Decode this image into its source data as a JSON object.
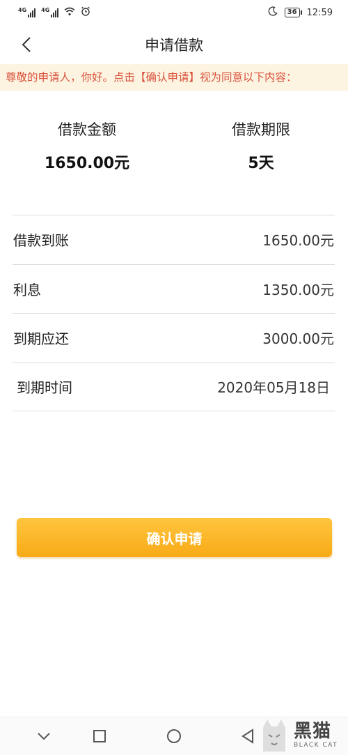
{
  "status_bar": {
    "network_1": "4G",
    "network_2": "4G",
    "battery": "36",
    "time": "12:59"
  },
  "header": {
    "title": "申请借款"
  },
  "notice": {
    "text": "尊敬的申请人，你好。点击【确认申请】视为同意以下内容："
  },
  "summary": {
    "amount_label": "借款金额",
    "amount_value": "1650.00元",
    "term_label": "借款期限",
    "term_value": "5天"
  },
  "details": [
    {
      "label": "借款到账",
      "value": "1650.00元"
    },
    {
      "label": "利息",
      "value": "1350.00元"
    },
    {
      "label": "到期应还",
      "value": "3000.00元"
    },
    {
      "label": "到期时间",
      "value": "2020年05月18日"
    }
  ],
  "confirm_button": {
    "label": "确认申请"
  },
  "watermark": {
    "cn": "黑猫",
    "en": "BLACK CAT"
  },
  "colors": {
    "accent": "#f8aa16",
    "notice_text": "#d9533c",
    "notice_bg": "#fdf3e1"
  }
}
